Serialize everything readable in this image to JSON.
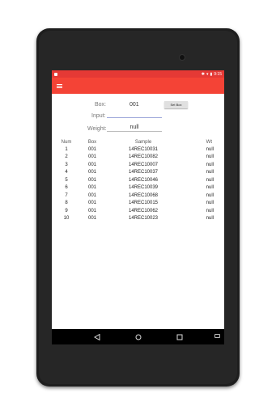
{
  "statusbar": {
    "time": "9:15"
  },
  "form": {
    "box_label": "Box:",
    "box_value": "001",
    "set_box_label": "Set Box",
    "input_label": "Input:",
    "input_value": "",
    "weight_label": "Weight:",
    "weight_value": "null"
  },
  "table": {
    "headers": [
      "Num",
      "Box",
      "Sample",
      "Wt"
    ],
    "rows": [
      [
        "1",
        "001",
        "14REC10031",
        "null"
      ],
      [
        "2",
        "001",
        "14REC10082",
        "null"
      ],
      [
        "3",
        "001",
        "14REC10007",
        "null"
      ],
      [
        "4",
        "001",
        "14REC10037",
        "null"
      ],
      [
        "5",
        "001",
        "14REC10046",
        "null"
      ],
      [
        "6",
        "001",
        "14REC10039",
        "null"
      ],
      [
        "7",
        "001",
        "14REC10068",
        "null"
      ],
      [
        "8",
        "001",
        "14REC10015",
        "null"
      ],
      [
        "9",
        "001",
        "14REC10062",
        "null"
      ],
      [
        "10",
        "001",
        "14REC10023",
        "null"
      ]
    ]
  },
  "icons": {
    "menu": "hamburger-menu-icon",
    "back": "back-triangle-icon",
    "home": "home-circle-icon",
    "recents": "recents-square-icon",
    "keyboard": "keyboard-icon"
  },
  "colors": {
    "accent": "#f44336",
    "statusbar": "#e53935"
  }
}
